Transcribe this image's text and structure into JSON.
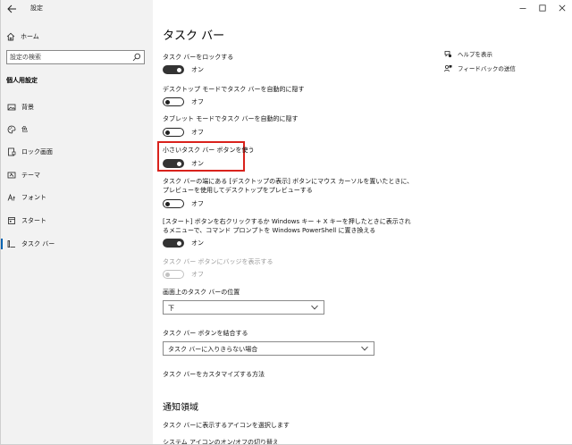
{
  "app": {
    "title": "設定"
  },
  "sidebar": {
    "home_label": "ホーム",
    "search_placeholder": "設定の検索",
    "section_title": "個人用設定",
    "items": [
      {
        "label": "背景",
        "icon": "image-icon"
      },
      {
        "label": "色",
        "icon": "palette-icon"
      },
      {
        "label": "ロック画面",
        "icon": "lock-screen-icon"
      },
      {
        "label": "テーマ",
        "icon": "theme-icon"
      },
      {
        "label": "フォント",
        "icon": "font-icon"
      },
      {
        "label": "スタート",
        "icon": "start-icon"
      },
      {
        "label": "タスク バー",
        "icon": "taskbar-icon",
        "active": true
      }
    ]
  },
  "main": {
    "title": "タスク バー",
    "settings": [
      {
        "label": "タスク バーをロックする",
        "state": "オン",
        "on": true
      },
      {
        "label": "デスクトップ モードでタスク バーを自動的に隠す",
        "state": "オフ",
        "on": false
      },
      {
        "label": "タブレット モードでタスク バーを自動的に隠す",
        "state": "オフ",
        "on": false
      },
      {
        "label": "小さいタスク バー ボタンを使う",
        "state": "オン",
        "on": true,
        "highlighted": true
      },
      {
        "label_line1": "タスク バーの端にある [デスクトップの表示] ボタンにマウス カーソルを置いたときに、",
        "label_line2": "プレビューを使用してデスクトップをプレビューする",
        "state": "オフ",
        "on": false
      },
      {
        "label_line1": "[スタート] ボタンを右クリックするか Windows キー + X キーを押したときに表示され",
        "label_line2": "るメニューで、コマンド プロンプトを Windows PowerShell に置き換える",
        "state": "オン",
        "on": true
      },
      {
        "label": "タスク バー ボタンにバッジを表示する",
        "state": "オフ",
        "on": false,
        "disabled": true
      }
    ],
    "position": {
      "label": "画面上のタスク バーの位置",
      "value": "下"
    },
    "combine": {
      "label": "タスク バー ボタンを結合する",
      "value": "タスク バーに入りきらない場合"
    },
    "customize_link": "タスク バーをカスタマイズする方法",
    "notification_area": {
      "heading": "通知領域",
      "link1": "タスク バーに表示するアイコンを選択します",
      "link2": "システム アイコンのオン/オフの切り替え"
    },
    "help": {
      "show_help": "ヘルプを表示",
      "feedback": "フィードバックの送信"
    }
  },
  "colors": {
    "sidebar_bg": "#f2f2f2",
    "accent": "#0063b1",
    "highlight": "#d9221c",
    "toggle_on": "#333333"
  }
}
